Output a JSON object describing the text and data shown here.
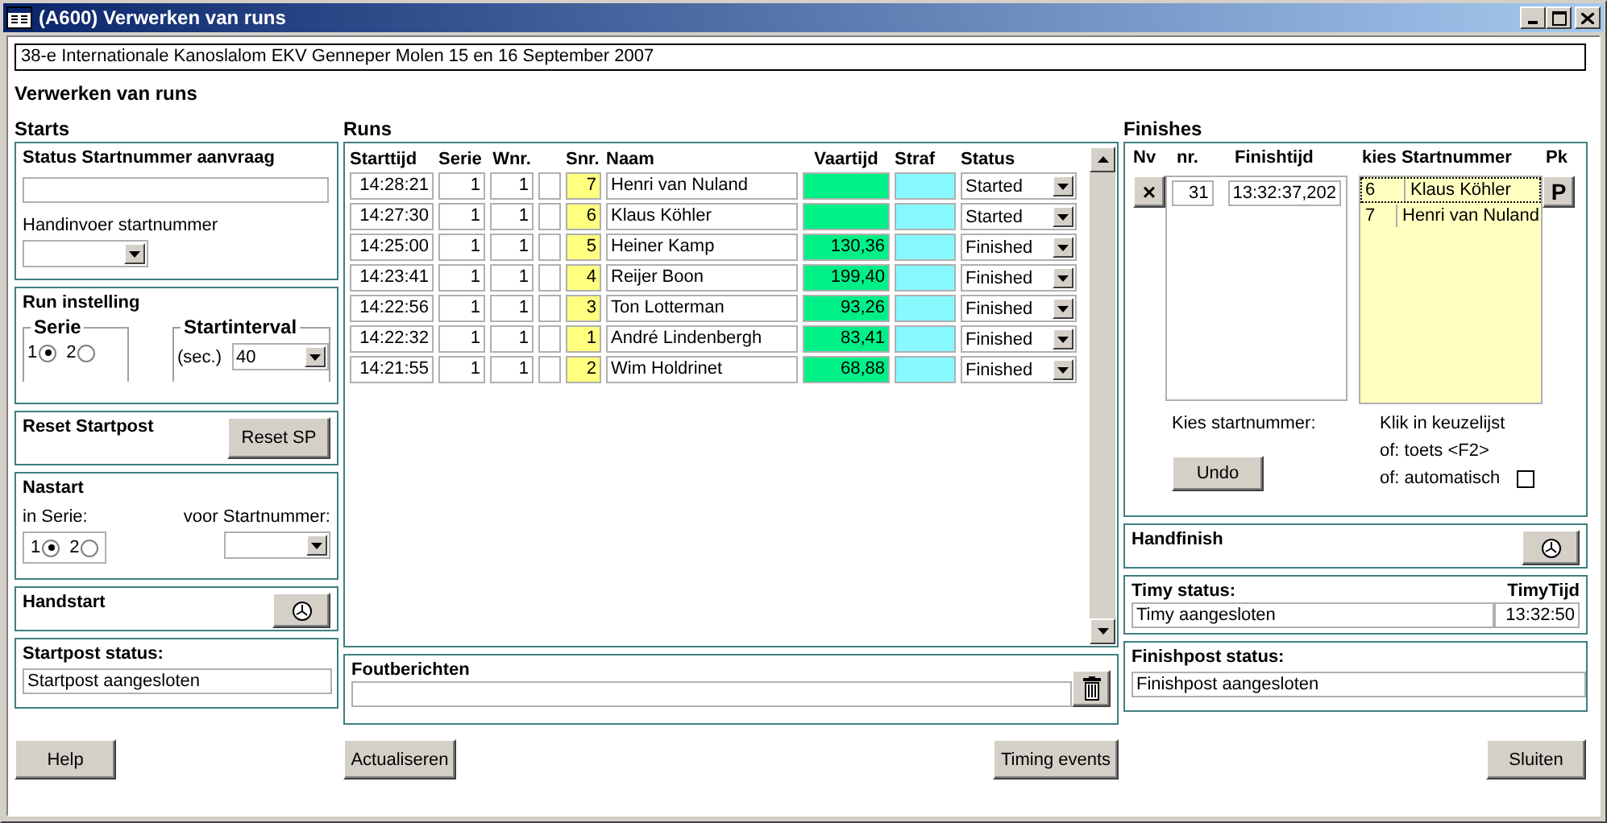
{
  "window": {
    "title": "(A600) Verwerken van runs"
  },
  "event_title": "38-e Internationale Kanoslalom EKV Genneper Molen 15 en 16 September 2007",
  "page_title": "Verwerken van runs",
  "starts": {
    "heading": "Starts",
    "status_request": {
      "title": "Status Startnummer aanvraag",
      "hand_entry_label": "Handinvoer startnummer"
    },
    "run_setting": {
      "title": "Run instelling",
      "serie_label": "Serie",
      "serie_options": [
        {
          "label": "1",
          "selected": true
        },
        {
          "label": "2",
          "selected": false
        }
      ],
      "interval_label": "Startinterval",
      "interval_unit": "(sec.)",
      "interval_value": "40"
    },
    "reset": {
      "title": "Reset Startpost",
      "button": "Reset SP"
    },
    "nastart": {
      "title": "Nastart",
      "series_label": "in Serie:",
      "number_label": "voor Startnummer:",
      "options": [
        {
          "label": "1",
          "selected": true
        },
        {
          "label": "2",
          "selected": false
        }
      ]
    },
    "handstart": {
      "title": "Handstart"
    },
    "startpost_status": {
      "title": "Startpost status:",
      "value": "Startpost aangesloten"
    }
  },
  "runs": {
    "heading": "Runs",
    "columns": [
      "Starttijd",
      "Serie",
      "Wnr.",
      "Snr.",
      "Naam",
      "Vaartijd",
      "Straf",
      "Status"
    ],
    "rows": [
      {
        "starttijd": "14:28:21",
        "serie": "1",
        "wnr": "1",
        "snr": "7",
        "naam": "Henri van Nuland",
        "status": "Started"
      },
      {
        "starttijd": "14:27:30",
        "serie": "1",
        "wnr": "1",
        "snr": "6",
        "naam": "Klaus Köhler",
        "status": "Started"
      },
      {
        "starttijd": "14:25:00",
        "serie": "1",
        "wnr": "1",
        "snr": "5",
        "naam": "Heiner Kamp",
        "vaartijd": "130,36",
        "status": "Finished"
      },
      {
        "starttijd": "14:23:41",
        "serie": "1",
        "wnr": "1",
        "snr": "4",
        "naam": "Reijer Boon",
        "vaartijd": "199,40",
        "status": "Finished"
      },
      {
        "starttijd": "14:22:56",
        "serie": "1",
        "wnr": "1",
        "snr": "3",
        "naam": "Ton Lotterman",
        "vaartijd": "93,26",
        "status": "Finished"
      },
      {
        "starttijd": "14:22:32",
        "serie": "1",
        "wnr": "1",
        "snr": "1",
        "naam": "André Lindenbergh",
        "vaartijd": "83,41",
        "status": "Finished"
      },
      {
        "starttijd": "14:21:55",
        "serie": "1",
        "wnr": "1",
        "snr": "2",
        "naam": "Wim Holdrinet",
        "vaartijd": "68,88",
        "status": "Finished"
      }
    ]
  },
  "errors": {
    "title": "Foutberichten"
  },
  "finishes": {
    "heading": "Finishes",
    "columns": [
      "Nv",
      "nr.",
      "Finishtijd",
      "kies Startnummer",
      "Pk"
    ],
    "delete_button": "×",
    "pick_button": "P",
    "entry": {
      "nr": "31",
      "time": "13:32:37,202"
    },
    "candidates": [
      {
        "number": "6",
        "name": "Klaus Köhler",
        "selected": true
      },
      {
        "number": "7",
        "name": "Henri van Nuland",
        "selected": false
      }
    ],
    "choose_label": "Kies startnummer:",
    "undo_button": "Undo",
    "hints": [
      "Klik in keuzelijst",
      "of: toets <F2>",
      "of: automatisch"
    ],
    "automatic": false
  },
  "handfinish": {
    "title": "Handfinish"
  },
  "timy": {
    "title": "Timy status:",
    "time_title": "TimyTijd",
    "status": "Timy aangesloten",
    "time": "13:32:50"
  },
  "finishpost_status": {
    "title": "Finishpost status:",
    "value": "Finishpost aangesloten"
  },
  "footer": {
    "help": "Help",
    "refresh": "Actualiseren",
    "timing_events": "Timing events",
    "close": "Sluiten"
  }
}
